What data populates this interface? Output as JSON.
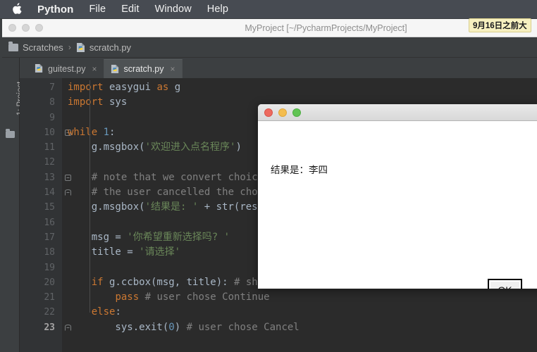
{
  "menubar": {
    "apple_icon": "apple-logo",
    "items": [
      {
        "label": "Python",
        "bold": true
      },
      {
        "label": "File"
      },
      {
        "label": "Edit"
      },
      {
        "label": "Window"
      },
      {
        "label": "Help"
      }
    ]
  },
  "tooltip": {
    "text": "9月16日之前大"
  },
  "ide": {
    "window_title": "MyProject [~/PycharmProjects/MyProject]",
    "traffic_lights": [
      "close",
      "minimize",
      "zoom"
    ],
    "breadcrumb": {
      "folder": "Scratches",
      "separator": "›",
      "file": "scratch.py"
    },
    "sidebar": {
      "project_tool_label": "1: Project",
      "folder_icon": "folder-icon"
    },
    "tabs": [
      {
        "label": "guitest.py",
        "active": false,
        "close": "×"
      },
      {
        "label": "scratch.py",
        "active": true,
        "close": "×"
      }
    ]
  },
  "editor": {
    "lines": [
      {
        "num": "7",
        "current": false,
        "fold": null,
        "tokens": [
          {
            "t": "import",
            "c": "k"
          },
          {
            "t": " easygui ",
            "c": "f"
          },
          {
            "t": "as",
            "c": "k"
          },
          {
            "t": " g",
            "c": "f"
          }
        ]
      },
      {
        "num": "8",
        "current": false,
        "fold": null,
        "tokens": [
          {
            "t": "import",
            "c": "k"
          },
          {
            "t": " sys",
            "c": "f"
          }
        ]
      },
      {
        "num": "9",
        "current": false,
        "fold": null,
        "tokens": []
      },
      {
        "num": "10",
        "current": false,
        "fold": "minus",
        "tokens": [
          {
            "t": "while",
            "c": "k"
          },
          {
            "t": " ",
            "c": "f"
          },
          {
            "t": "1",
            "c": "n"
          },
          {
            "t": ":",
            "c": "f"
          }
        ]
      },
      {
        "num": "11",
        "current": false,
        "fold": null,
        "tokens": [
          {
            "t": "    g.msgbox(",
            "c": "f"
          },
          {
            "t": "'欢迎进入点名程序'",
            "c": "s"
          },
          {
            "t": ")",
            "c": "f"
          }
        ]
      },
      {
        "num": "12",
        "current": false,
        "fold": null,
        "tokens": []
      },
      {
        "num": "13",
        "current": false,
        "fold": "minus",
        "tokens": [
          {
            "t": "    # note that we convert choice",
            "c": "c"
          }
        ]
      },
      {
        "num": "14",
        "current": false,
        "fold": "end",
        "tokens": [
          {
            "t": "    # the user cancelled the choi",
            "c": "c"
          }
        ]
      },
      {
        "num": "15",
        "current": false,
        "fold": null,
        "tokens": [
          {
            "t": "    g.msgbox(",
            "c": "f"
          },
          {
            "t": "'结果是: '",
            "c": "s"
          },
          {
            "t": " + ",
            "c": "f"
          },
          {
            "t": "str",
            "c": "fn"
          },
          {
            "t": "(resu",
            "c": "f"
          }
        ]
      },
      {
        "num": "16",
        "current": false,
        "fold": null,
        "tokens": []
      },
      {
        "num": "17",
        "current": false,
        "fold": null,
        "tokens": [
          {
            "t": "    msg = ",
            "c": "f"
          },
          {
            "t": "'你希望重新选择吗? '",
            "c": "s"
          }
        ]
      },
      {
        "num": "18",
        "current": false,
        "fold": null,
        "tokens": [
          {
            "t": "    title = ",
            "c": "f"
          },
          {
            "t": "'请选择'",
            "c": "s"
          }
        ]
      },
      {
        "num": "19",
        "current": false,
        "fold": null,
        "tokens": []
      },
      {
        "num": "20",
        "current": false,
        "fold": null,
        "tokens": [
          {
            "t": "    ",
            "c": "f"
          },
          {
            "t": "if",
            "c": "k"
          },
          {
            "t": " g.ccbox(msg, title): ",
            "c": "f"
          },
          {
            "t": "# sho",
            "c": "c"
          }
        ]
      },
      {
        "num": "21",
        "current": false,
        "fold": null,
        "tokens": [
          {
            "t": "        ",
            "c": "f"
          },
          {
            "t": "pass",
            "c": "k"
          },
          {
            "t": " ",
            "c": "f"
          },
          {
            "t": "# user chose Continue",
            "c": "c"
          }
        ]
      },
      {
        "num": "22",
        "current": false,
        "fold": null,
        "tokens": [
          {
            "t": "    ",
            "c": "f"
          },
          {
            "t": "else",
            "c": "k"
          },
          {
            "t": ":",
            "c": "f"
          }
        ]
      },
      {
        "num": "23",
        "current": true,
        "fold": "end",
        "tokens": [
          {
            "t": "        sys.exit(",
            "c": "f"
          },
          {
            "t": "0",
            "c": "n"
          },
          {
            "t": ") ",
            "c": "f"
          },
          {
            "t": "# user chose Cancel",
            "c": "c"
          }
        ]
      }
    ]
  },
  "dialog": {
    "traffic_lights": [
      "close",
      "minimize",
      "zoom"
    ],
    "message": "结果是：李四",
    "ok_label": "OK"
  },
  "colors": {
    "menubar_bg": "#474b52",
    "ide_chrome": "#3c3f41",
    "editor_bg": "#2b2b2b",
    "gutter_bg": "#313335",
    "keyword": "#cc7832",
    "string": "#6a8759",
    "comment": "#808080",
    "number": "#6897bb",
    "default_text": "#a9b7c6",
    "tooltip_bg": "#f7f0c0",
    "dialog_bg": "#ffffff"
  }
}
